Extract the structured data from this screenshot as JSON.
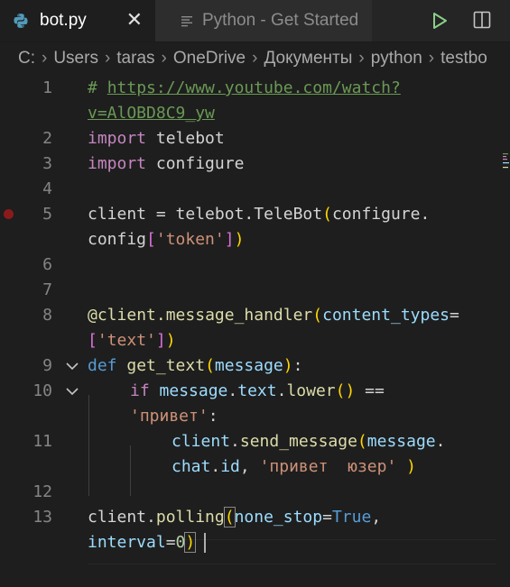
{
  "tabs": [
    {
      "label": "bot.py",
      "close": "✕"
    },
    {
      "label": "Python - Get Started"
    }
  ],
  "breadcrumb": [
    "C:",
    "Users",
    "taras",
    "OneDrive",
    "Документы",
    "python",
    "testbo"
  ],
  "breadcrumb_sep": "›",
  "colors": {
    "background": "#1e1e1e",
    "keyword": "#c586c0",
    "comment": "#6a9955",
    "string": "#ce9178",
    "function": "#dcdcaa",
    "variable": "#9cdcfe",
    "breakpoint": "#8b1a1a",
    "run": "#89d185"
  },
  "gutter": {
    "breakpoint_line": "5",
    "fold_lines": [
      "9",
      "10"
    ]
  },
  "code": {
    "l1_hash": "# ",
    "l1_url_a": "https://www.youtube.com/watch?",
    "l1_url_b": "v=AlOBD8C9_yw",
    "l2_kw": "import",
    "l2_name": "telebot",
    "l3_kw": "import",
    "l3_name": "configure",
    "l5_a": "client",
    "l5_b": " = ",
    "l5_c": "telebot",
    "l5_d": ".",
    "l5_e": "TeleBot",
    "l5_f": "(",
    "l5_g": "configure",
    "l5_h": ".",
    "l5_i": "config",
    "l5_j": "[",
    "l5_k": "'token'",
    "l5_l": "]",
    "l5_m": ")",
    "l8_a": "@",
    "l8_b": "client",
    "l8_c": ".",
    "l8_d": "message_handler",
    "l8_e": "(",
    "l8_f": "content_types",
    "l8_g": "=",
    "l8_h": "[",
    "l8_i": "'text'",
    "l8_j": "]",
    "l8_k": ")",
    "l9_kw": "def",
    "l9_fn": "get_text",
    "l9_p1": "(",
    "l9_arg": "message",
    "l9_p2": ")",
    "l9_colon": ":",
    "l10_kw": "if",
    "l10_a": "message",
    "l10_b": ".",
    "l10_c": "text",
    "l10_d": ".",
    "l10_e": "lower",
    "l10_f": "()",
    "l10_g": " ==",
    "l10_str": "'привет'",
    "l10_colon": ":",
    "l11_a": "client",
    "l11_b": ".",
    "l11_c": "send_message",
    "l11_d": "(",
    "l11_e": "message",
    "l11_f": ".",
    "l11_g": "chat",
    "l11_h": ".",
    "l11_i": "id",
    "l11_j": ", ",
    "l11_str": "'привет  юзер'",
    "l11_k": " )",
    "l13_a": "client",
    "l13_b": ".",
    "l13_c": "polling",
    "l13_d": "(",
    "l13_e": "none_stop",
    "l13_f": "=",
    "l13_g": "True",
    "l13_h": ",",
    "l13_i": "interval",
    "l13_j": "=",
    "l13_k": "0",
    "l13_l": ")"
  },
  "line_numbers": {
    "n1": "1",
    "n2": "2",
    "n3": "3",
    "n4": "4",
    "n5": "5",
    "n6": "6",
    "n7": "7",
    "n8": "8",
    "n9": "9",
    "n10": "10",
    "n11": "11",
    "n12": "12",
    "n13": "13"
  }
}
